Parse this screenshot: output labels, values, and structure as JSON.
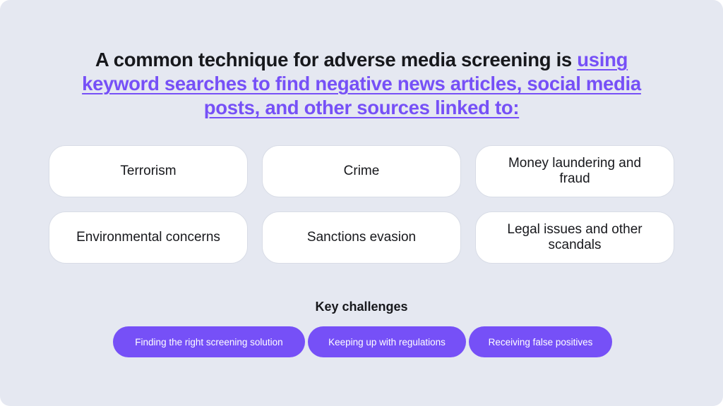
{
  "headline": {
    "plain": "A common technique for adverse media screening is ",
    "link": "using keyword searches to find negative news articles, social media posts, and other sources linked to:"
  },
  "colors": {
    "background": "#e5e8f1",
    "accent": "#7650f7",
    "card": "#ffffff",
    "text": "#17181c"
  },
  "categories": [
    {
      "label": "Terrorism"
    },
    {
      "label": "Crime"
    },
    {
      "label": "Money laundering and fraud"
    },
    {
      "label": "Environmental concerns"
    },
    {
      "label": "Sanctions evasion"
    },
    {
      "label": "Legal issues and other scandals"
    }
  ],
  "challenges": {
    "title": "Key challenges",
    "items": [
      {
        "label": "Finding the right screening solution"
      },
      {
        "label": "Keeping up with regulations"
      },
      {
        "label": "Receiving false positives"
      }
    ]
  }
}
